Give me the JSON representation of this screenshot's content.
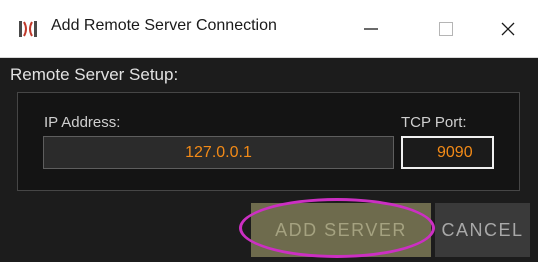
{
  "window": {
    "title": "Add Remote Server Connection",
    "app_icon": "orbit-logo-icon",
    "controls": {
      "minimize_icon": "minimize-icon",
      "maximize_icon": "maximize-icon",
      "close_icon": "close-icon"
    }
  },
  "form": {
    "section_label": "Remote Server Setup:",
    "ip_label": "IP Address:",
    "ip_value": "127.0.0.1",
    "port_label": "TCP Port:",
    "port_value": "9090"
  },
  "buttons": {
    "add_label": "ADD SERVER",
    "cancel_label": "CANCEL"
  },
  "colors": {
    "accent_text": "#f28a17",
    "highlight": "#cc2fc3",
    "add_button": "#6e6b4d"
  }
}
